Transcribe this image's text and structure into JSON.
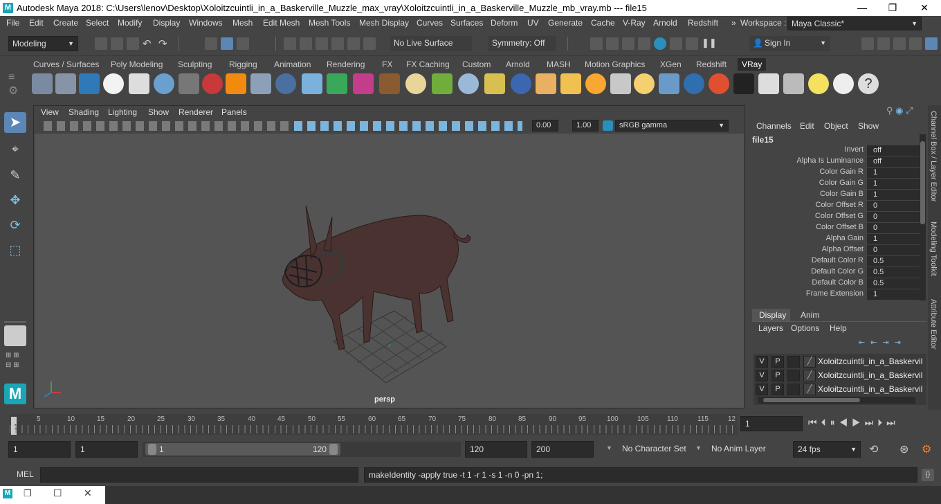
{
  "window": {
    "title": "Autodesk Maya 2018: C:\\Users\\lenov\\Desktop\\Xoloitzcuintli_in_a_Baskerville_Muzzle_max_vray\\Xoloitzcuintli_in_a_Baskerville_Muzzle_mb_vray.mb  ---  file15",
    "logo": "M",
    "minimize": "—",
    "maximize": "❐",
    "close": "✕"
  },
  "menubar": {
    "items": [
      "File",
      "Edit",
      "Create",
      "Select",
      "Modify",
      "Display",
      "Windows",
      "Mesh",
      "Edit Mesh",
      "Mesh Tools",
      "Mesh Display",
      "Curves",
      "Surfaces",
      "Deform",
      "UV",
      "Generate",
      "Cache",
      "V-Ray",
      "Arnold",
      "Redshift"
    ],
    "workspace_label": "Workspace :",
    "workspace_value": "Maya Classic*",
    "overflow": "»"
  },
  "statusline": {
    "mode": "Modeling",
    "live_surface": "No Live Surface",
    "symmetry": "Symmetry: Off",
    "sign_in": "Sign In"
  },
  "shelf": {
    "tabs": [
      "Curves / Surfaces",
      "Poly Modeling",
      "Sculpting",
      "Rigging",
      "Animation",
      "Rendering",
      "FX",
      "FX Caching",
      "Custom",
      "Arnold",
      "MASH",
      "Motion Graphics",
      "XGen",
      "Redshift",
      "VRay"
    ],
    "active_tab": "VRay"
  },
  "viewport": {
    "menu": [
      "View",
      "Shading",
      "Lighting",
      "Show",
      "Renderer",
      "Panels"
    ],
    "near_value": "0.00",
    "gamma_value": "1.00",
    "color_space": "sRGB gamma",
    "camera_label": "persp"
  },
  "channelbox": {
    "menu": [
      "Channels",
      "Edit",
      "Object",
      "Show"
    ],
    "node_name": "file15",
    "attributes": [
      {
        "label": "Invert",
        "value": "off"
      },
      {
        "label": "Alpha Is Luminance",
        "value": "off"
      },
      {
        "label": "Color Gain R",
        "value": "1"
      },
      {
        "label": "Color Gain G",
        "value": "1"
      },
      {
        "label": "Color Gain B",
        "value": "1"
      },
      {
        "label": "Color Offset R",
        "value": "0"
      },
      {
        "label": "Color Offset G",
        "value": "0"
      },
      {
        "label": "Color Offset B",
        "value": "0"
      },
      {
        "label": "Alpha Gain",
        "value": "1"
      },
      {
        "label": "Alpha Offset",
        "value": "0"
      },
      {
        "label": "Default Color R",
        "value": "0.5"
      },
      {
        "label": "Default Color G",
        "value": "0.5"
      },
      {
        "label": "Default Color B",
        "value": "0.5"
      },
      {
        "label": "Frame Extension",
        "value": "1"
      }
    ]
  },
  "sidetabs": [
    "Channel Box / Layer Editor",
    "Modeling Toolkit",
    "Attribute Editor"
  ],
  "layereditor": {
    "tabs": [
      "Display",
      "Anim"
    ],
    "active_tab": "Display",
    "menu": [
      "Layers",
      "Options",
      "Help"
    ],
    "layers": [
      {
        "v": "V",
        "p": "P",
        "name": "Xoloitzcuintli_in_a_Baskervil"
      },
      {
        "v": "V",
        "p": "P",
        "name": "Xoloitzcuintli_in_a_Baskervil"
      },
      {
        "v": "V",
        "p": "P",
        "name": "Xoloitzcuintli_in_a_Baskervil"
      }
    ]
  },
  "timeslider": {
    "ticks": [
      "1",
      "5",
      "10",
      "15",
      "20",
      "25",
      "30",
      "35",
      "40",
      "45",
      "50",
      "55",
      "60",
      "65",
      "70",
      "75",
      "80",
      "85",
      "90",
      "95",
      "100",
      "105",
      "110",
      "115",
      "12"
    ],
    "current_frame": "1"
  },
  "rangeslider": {
    "start": "1",
    "playback_start": "1",
    "range_start_label": "1",
    "range_end_label": "120",
    "playback_end": "120",
    "end": "200",
    "character_set": "No Character Set",
    "anim_layer": "No Anim Layer",
    "fps": "24 fps"
  },
  "cmdline": {
    "language": "MEL",
    "result": "makeIdentity -apply true -t 1 -r 1 -s 1 -n 0 -pn 1;"
  }
}
